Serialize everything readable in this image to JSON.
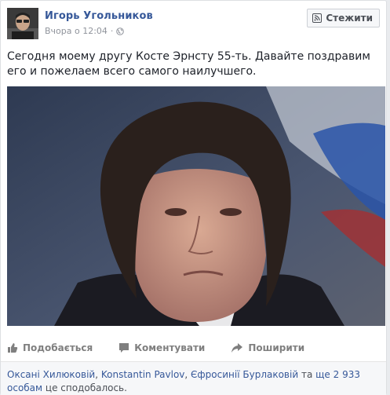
{
  "post": {
    "author": "Игорь Угольников",
    "timestamp": "Вчора о 12:04",
    "separator": "·",
    "follow_label": "Стежити",
    "text": "Сегодня моему другу Косте Эрнсту 55-ть. Давайте поздравим его и пожелаем всего самого наилучшего."
  },
  "actions": {
    "like_label": "Подобається",
    "comment_label": "Коментувати",
    "share_label": "Поширити"
  },
  "likes": {
    "name1": "Оксані Хилюковій",
    "comma1": ", ",
    "name2": "Konstantin Pavlov",
    "comma2": ", ",
    "name3": "Єфросинії Бурлаковій",
    "mid": " та ",
    "others": "ще 2 933 особам",
    "tail": " це сподобалось."
  },
  "colors": {
    "link": "#365899",
    "meta": "#90949c",
    "action": "#7f7f7f"
  }
}
